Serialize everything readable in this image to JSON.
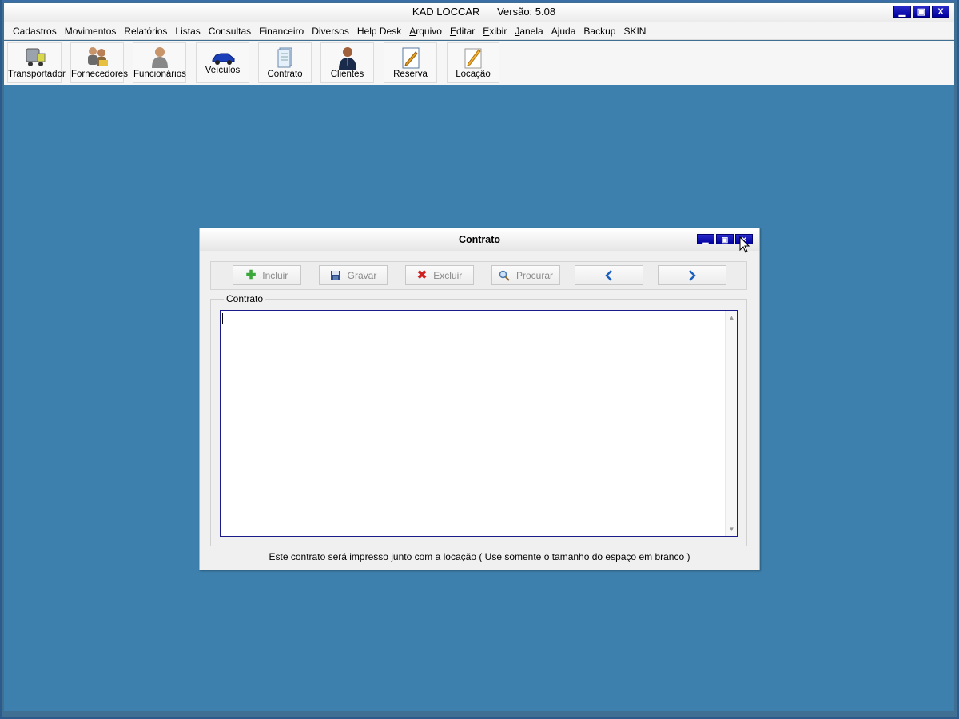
{
  "app": {
    "title": "KAD LOCCAR",
    "version": "Versão: 5.08",
    "window_controls": [
      "_",
      "□",
      "X"
    ]
  },
  "menu": [
    {
      "label": "Cadastros",
      "underline": false
    },
    {
      "label": "Movimentos",
      "underline": false
    },
    {
      "label": "Relatórios",
      "underline": false
    },
    {
      "label": "Listas",
      "underline": false
    },
    {
      "label": "Consultas",
      "underline": false
    },
    {
      "label": "Financeiro",
      "underline": false
    },
    {
      "label": "Diversos",
      "underline": false
    },
    {
      "label": "Help Desk",
      "underline": false
    },
    {
      "label": "Arquivo",
      "underline": true
    },
    {
      "label": "Editar",
      "underline": true
    },
    {
      "label": "Exibir",
      "underline": true
    },
    {
      "label": "Janela",
      "underline": true
    },
    {
      "label": "Ajuda",
      "underline": false
    },
    {
      "label": "Backup",
      "underline": false
    },
    {
      "label": "SKIN",
      "underline": false
    }
  ],
  "toolbar": [
    {
      "label": "Transportador",
      "icon": "truck-icon"
    },
    {
      "label": "Fornecedores",
      "icon": "suppliers-icon"
    },
    {
      "label": "Funcionários",
      "icon": "employee-icon"
    },
    {
      "label": "Veículos",
      "icon": "car-icon"
    },
    {
      "label": "Contrato",
      "icon": "document-icon"
    },
    {
      "label": "Clientes",
      "icon": "client-icon"
    },
    {
      "label": "Reserva",
      "icon": "reservation-icon"
    },
    {
      "label": "Locação",
      "icon": "rental-pencil-icon"
    }
  ],
  "dialog": {
    "title": "Contrato",
    "buttons": {
      "incluir": "Incluir",
      "gravar": "Gravar",
      "excluir": "Excluir",
      "procurar": "Procurar"
    },
    "group_label": "Contrato",
    "text_value": "",
    "footer": "Este contrato será impresso junto com a locação ( Use somente o tamanho do espaço em branco )"
  },
  "colors": {
    "desktop": "#3e80ad",
    "window_button": "#0000a0",
    "add_icon": "#3aa83a",
    "delete_icon": "#d02020",
    "nav_arrow": "#1a5fbf"
  }
}
